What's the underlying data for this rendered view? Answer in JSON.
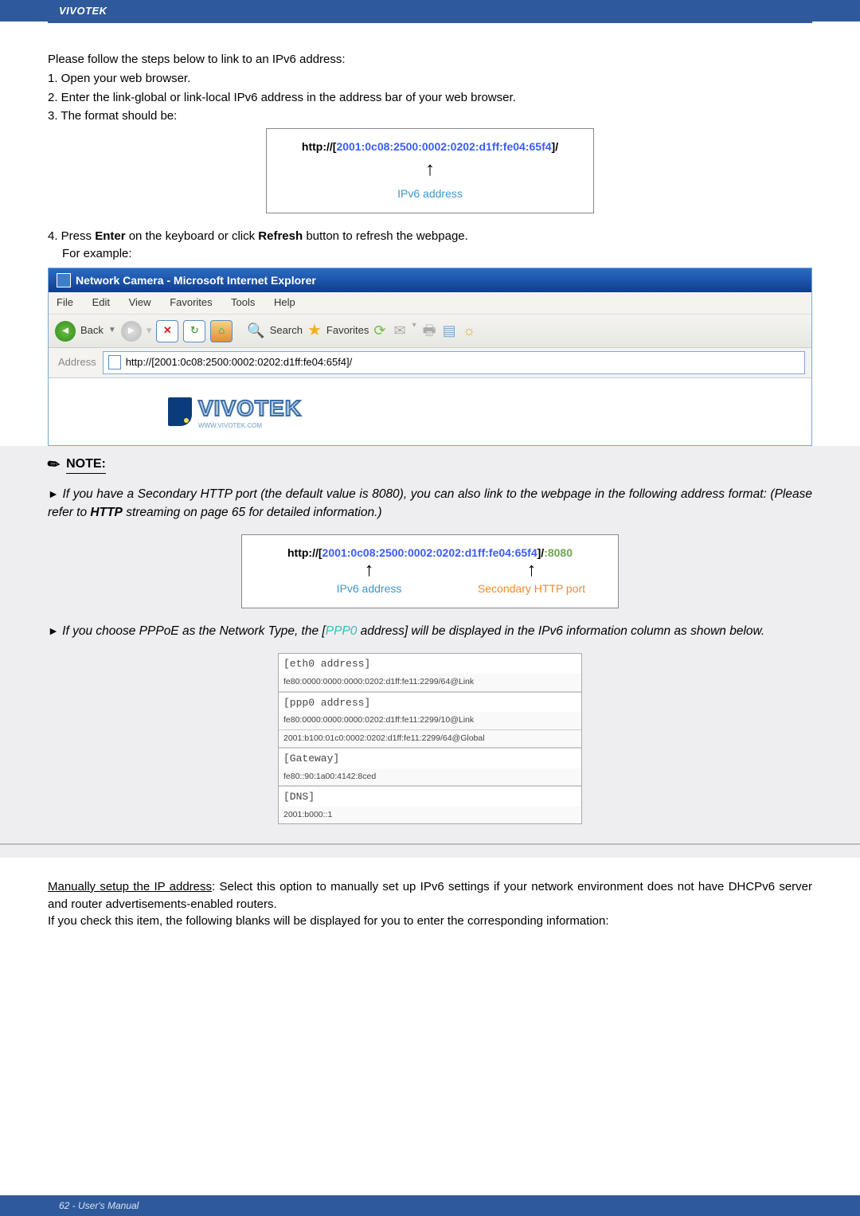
{
  "header": {
    "brand": "VIVOTEK"
  },
  "intro": {
    "lead": "Please follow the steps below to link to an IPv6 address:",
    "step1": "1. Open your web browser.",
    "step2": "2. Enter the link-global or link-local IPv6 address in the address bar of your web browser.",
    "step3": "3. The format should be:"
  },
  "diagram1": {
    "prefix": "http://",
    "open": "[",
    "addr": "2001:0c08:2500:0002:0202:d1ff:fe04:65f4",
    "close": "]",
    "suffix": "/",
    "label": "IPv6 address"
  },
  "step4": {
    "line1_a": "4. Press ",
    "enter": "Enter",
    "line1_b": " on the keyboard or click ",
    "refresh": "Refresh",
    "line1_c": " button to refresh the webpage.",
    "line2": "For example:"
  },
  "ie": {
    "title": "Network Camera - Microsoft Internet Explorer",
    "menu": {
      "file": "File",
      "edit": "Edit",
      "view": "View",
      "favorites": "Favorites",
      "tools": "Tools",
      "help": "Help"
    },
    "back": "Back",
    "search": "Search",
    "favorites_btn": "Favorites",
    "address_label": "Address",
    "address_value": "http://[2001:0c08:2500:0002:0202:d1ff:fe04:65f4]/",
    "logo_text": "VIVOTEK",
    "logo_sub": "WWW.VIVOTEK.COM"
  },
  "note": {
    "heading": "NOTE:",
    "p1_a": "If you have a Secondary HTTP port (the default value is 8080), you can also link to the webpage in the following address format: (Please refer to ",
    "p1_http": "HTTP",
    "p1_b": " streaming on page 65 for detailed information.)"
  },
  "diagram2": {
    "prefix": "http://",
    "open": "[",
    "addr": "2001:0c08:2500:0002:0202:d1ff:fe04:65f4",
    "close": "]",
    "mid": "/",
    "port": ":8080",
    "label_left": "IPv6 address",
    "label_right": "Secondary HTTP port"
  },
  "note2": {
    "a": "If you choose PPPoE as the Network Type, the [",
    "ppp0": "PPP0",
    "b": " address] will be displayed in the IPv6 information column as shown below."
  },
  "addr_table": {
    "eth0_label": "[eth0 address]",
    "eth0_val": "fe80:0000:0000:0000:0202:d1ff:fe11:2299/64@Link",
    "ppp0_label": "[ppp0 address]",
    "ppp0_val1": "fe80:0000:0000:0000:0202:d1ff:fe11:2299/10@Link",
    "ppp0_val2": "2001:b100:01c0:0002:0202:d1ff:fe11:2299/64@Global",
    "gw_label": "[Gateway]",
    "gw_val": "fe80::90:1a00:4142:8ced",
    "dns_label": "[DNS]",
    "dns_val": "2001:b000::1"
  },
  "manual": {
    "u": "Manually setup the IP address",
    "p1": ": Select this option to manually set up IPv6 settings if your network environment does not have DHCPv6 server and router advertisements-enabled routers.",
    "p2": "If you check this item, the following blanks will be displayed for you to enter the corresponding information:"
  },
  "footer": {
    "text": "62 - User's Manual"
  }
}
